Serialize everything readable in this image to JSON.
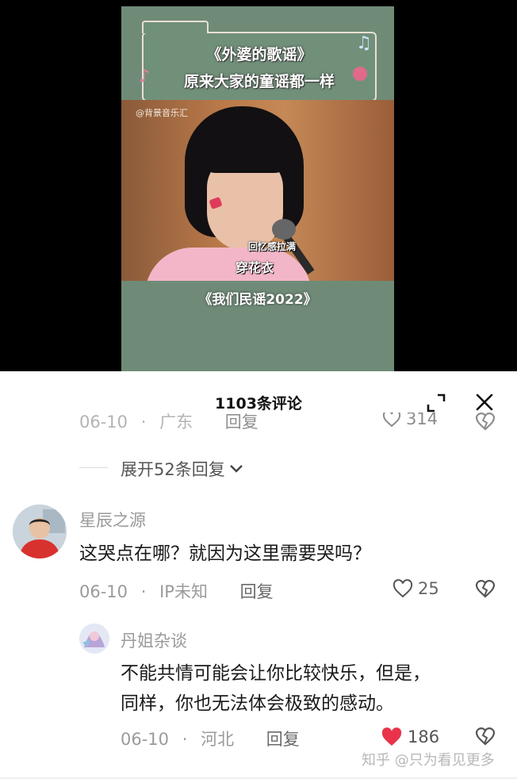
{
  "video": {
    "title_line1": "《外婆的歌谣》",
    "title_line2": "原来大家的童谣都一样",
    "watermark": "@背景音乐汇",
    "subtitle_small": "回忆感拉满",
    "subtitle_big": "穿花衣",
    "show_name": "《我们民谣2022》"
  },
  "panel": {
    "title": "1103条评论",
    "colors": {
      "like_active": "#e8334a",
      "muted": "#9a9a9a"
    }
  },
  "partial_comment": {
    "date": "06-10",
    "location": "广东",
    "reply_label": "回复",
    "likes": "314"
  },
  "expand_replies": {
    "label": "展开52条回复"
  },
  "comments": [
    {
      "username": "星辰之源",
      "text": "这哭点在哪？就因为这里需要哭吗？",
      "date": "06-10",
      "location": "IP未知",
      "reply_label": "回复",
      "likes": "25",
      "liked": false
    },
    {
      "username": "丹姐杂谈",
      "text_line1": "不能共情可能会让你比较快乐，但是，",
      "text_line2": "同样，你也无法体会极致的感动。",
      "date": "06-10",
      "location": "河北",
      "reply_label": "回复",
      "likes": "186",
      "liked": true
    }
  ],
  "footer": {
    "watermark": "知乎 @只为看见更多"
  }
}
